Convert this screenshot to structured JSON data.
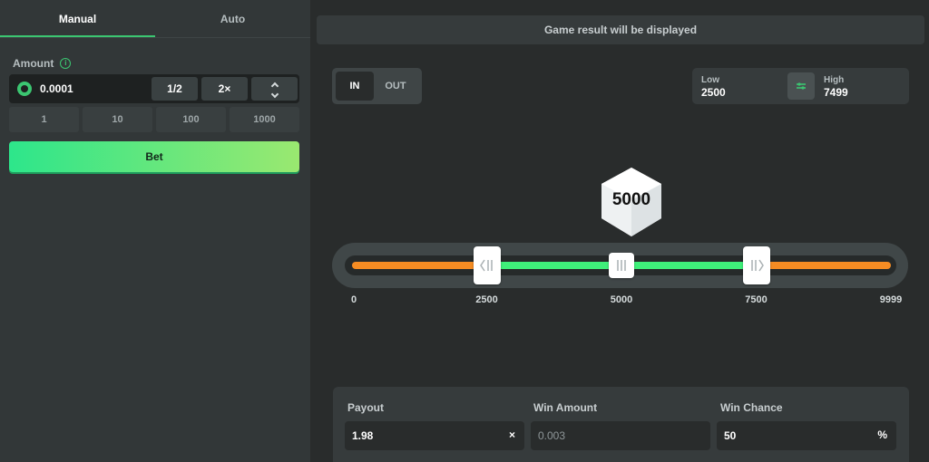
{
  "tabs": {
    "manual": "Manual",
    "auto": "Auto"
  },
  "bet_panel": {
    "amount_label": "Amount",
    "info_glyph": "i",
    "amount_value": "0.0001",
    "half_label": "1/2",
    "double_label": "2×",
    "presets": [
      "1",
      "10",
      "100",
      "1000"
    ],
    "bet_label": "Bet",
    "coin_icon": "coin-icon"
  },
  "game": {
    "result_text": "Game result will be displayed",
    "mode": {
      "in_label": "IN",
      "out_label": "OUT",
      "selected": "IN"
    },
    "range": {
      "low_label": "Low",
      "low_value": "2500",
      "high_label": "High",
      "high_value": "7499"
    },
    "dice_value": "5000",
    "slider": {
      "min": 0,
      "max": 9999,
      "low": 2500,
      "high": 7500,
      "marker": 5000,
      "ticks": [
        "0",
        "2500",
        "5000",
        "7500",
        "9999"
      ]
    }
  },
  "stats": {
    "payout_label": "Payout",
    "payout_value": "1.98",
    "payout_suffix": "×",
    "win_amount_label": "Win Amount",
    "win_amount_value": "0.003",
    "win_chance_label": "Win Chance",
    "win_chance_value": "50",
    "win_chance_suffix": "%"
  },
  "colors": {
    "accent": "#3bc671",
    "in_range": "#3ff07a",
    "out_range": "#f58c23",
    "bet_gradient_start": "#2de68b",
    "bet_gradient_end": "#9ae870"
  }
}
